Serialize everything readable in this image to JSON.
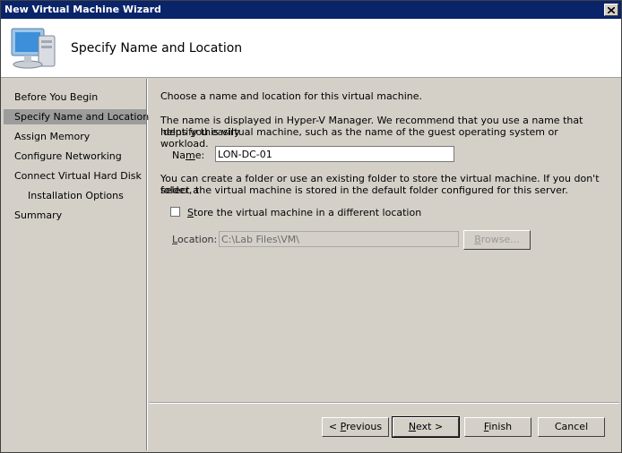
{
  "window": {
    "title": "New Virtual Machine Wizard"
  },
  "header": {
    "title": "Specify Name and Location",
    "icon": "computer-icon"
  },
  "nav": {
    "items": [
      {
        "label": "Before You Begin"
      },
      {
        "label": "Specify Name and Location",
        "active": true
      },
      {
        "label": "Assign Memory"
      },
      {
        "label": "Configure Networking"
      },
      {
        "label": "Connect Virtual Hard Disk"
      },
      {
        "label": "Installation Options"
      },
      {
        "label": "Summary"
      }
    ]
  },
  "content": {
    "intro": "Choose a name and location for this virtual machine.",
    "name_desc_1": "The name is displayed in Hyper-V Manager. We recommend that you use a name that helps you easily",
    "name_desc_2": "identify this virtual machine, such as the name of the guest operating system or workload.",
    "name_label": "Name:",
    "name_value": "LON-DC-01",
    "folder_desc_1": "You can create a folder or use an existing folder to store the virtual machine. If you don't select a",
    "folder_desc_2": "folder, the virtual machine is stored in the default folder configured for this server.",
    "store_checkbox_label": "Store the virtual machine in a different location",
    "location_label": "Location:",
    "location_value": "C:\\Lab Files\\VM\\",
    "browse_label": "Browse..."
  },
  "buttons": {
    "previous": "< Previous",
    "next": "Next >",
    "finish": "Finish",
    "cancel": "Cancel"
  }
}
